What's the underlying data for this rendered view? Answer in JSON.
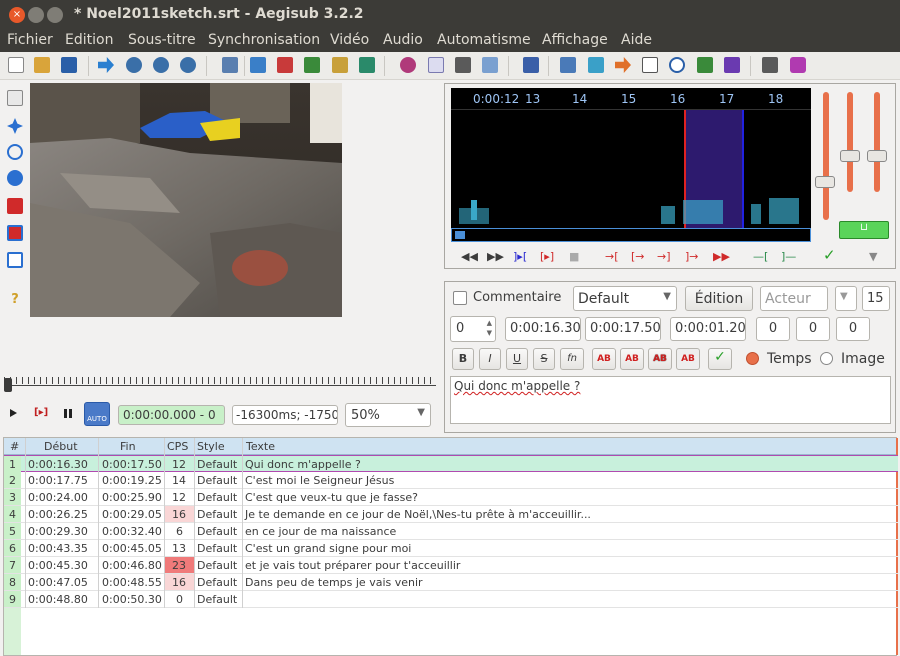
{
  "window": {
    "title": "* Noel2011sketch.srt - Aegisub 3.2.2",
    "close_glyph": "×"
  },
  "menu": [
    "Fichier",
    "Edition",
    "Sous-titre",
    "Synchronisation",
    "Vidéo",
    "Audio",
    "Automatisme",
    "Affichage",
    "Aide"
  ],
  "video_controls": {
    "time": "0:00:00.000 - 0",
    "offset": "-16300ms; -1750",
    "zoom": "50%",
    "auto_label": "AUTO"
  },
  "audio": {
    "ruler": [
      "0:00:12",
      "13",
      "14",
      "15",
      "16",
      "17",
      "18"
    ]
  },
  "edit": {
    "comment_label": "Commentaire",
    "style": "Default",
    "edit_button": "Édition",
    "actor_placeholder": "Acteur",
    "margin_count": "15",
    "layer": "0",
    "start": "0:00:16.30",
    "end": "0:00:17.50",
    "duration": "0:00:01.20",
    "margin_l": "0",
    "margin_r": "0",
    "margin_v": "0",
    "format_buttons": [
      "B",
      "I",
      "U",
      "S",
      "fn",
      "AB",
      "AB",
      "AB",
      "AB"
    ],
    "mode_time": "Temps",
    "mode_image": "Image",
    "text": "Qui donc m'appelle ?"
  },
  "grid": {
    "headers": [
      "#",
      "Début",
      "Fin",
      "CPS",
      "Style",
      "Texte"
    ],
    "rows": [
      {
        "n": "1",
        "start": "0:00:16.30",
        "end": "0:00:17.50",
        "cps": "12",
        "style": "Default",
        "text": "Qui donc m'appelle ?"
      },
      {
        "n": "2",
        "start": "0:00:17.75",
        "end": "0:00:19.25",
        "cps": "14",
        "style": "Default",
        "text": "C'est moi le Seigneur Jésus"
      },
      {
        "n": "3",
        "start": "0:00:24.00",
        "end": "0:00:25.90",
        "cps": "12",
        "style": "Default",
        "text": "C'est que veux-tu que je fasse?"
      },
      {
        "n": "4",
        "start": "0:00:26.25",
        "end": "0:00:29.05",
        "cps": "16",
        "style": "Default",
        "text": "Je te demande en ce jour de Noël,\\Nes-tu prête à m'acceuillir..."
      },
      {
        "n": "5",
        "start": "0:00:29.30",
        "end": "0:00:32.40",
        "cps": "6",
        "style": "Default",
        "text": "en ce jour de ma naissance"
      },
      {
        "n": "6",
        "start": "0:00:43.35",
        "end": "0:00:45.05",
        "cps": "13",
        "style": "Default",
        "text": "C'est un grand signe pour moi"
      },
      {
        "n": "7",
        "start": "0:00:45.30",
        "end": "0:00:46.80",
        "cps": "23",
        "style": "Default",
        "text": "et je vais tout préparer pour t'acceuillir"
      },
      {
        "n": "8",
        "start": "0:00:47.05",
        "end": "0:00:48.55",
        "cps": "16",
        "style": "Default",
        "text": "Dans peu de temps je vais venir"
      },
      {
        "n": "9",
        "start": "0:00:48.80",
        "end": "0:00:50.30",
        "cps": "0",
        "style": "Default",
        "text": ""
      }
    ]
  }
}
